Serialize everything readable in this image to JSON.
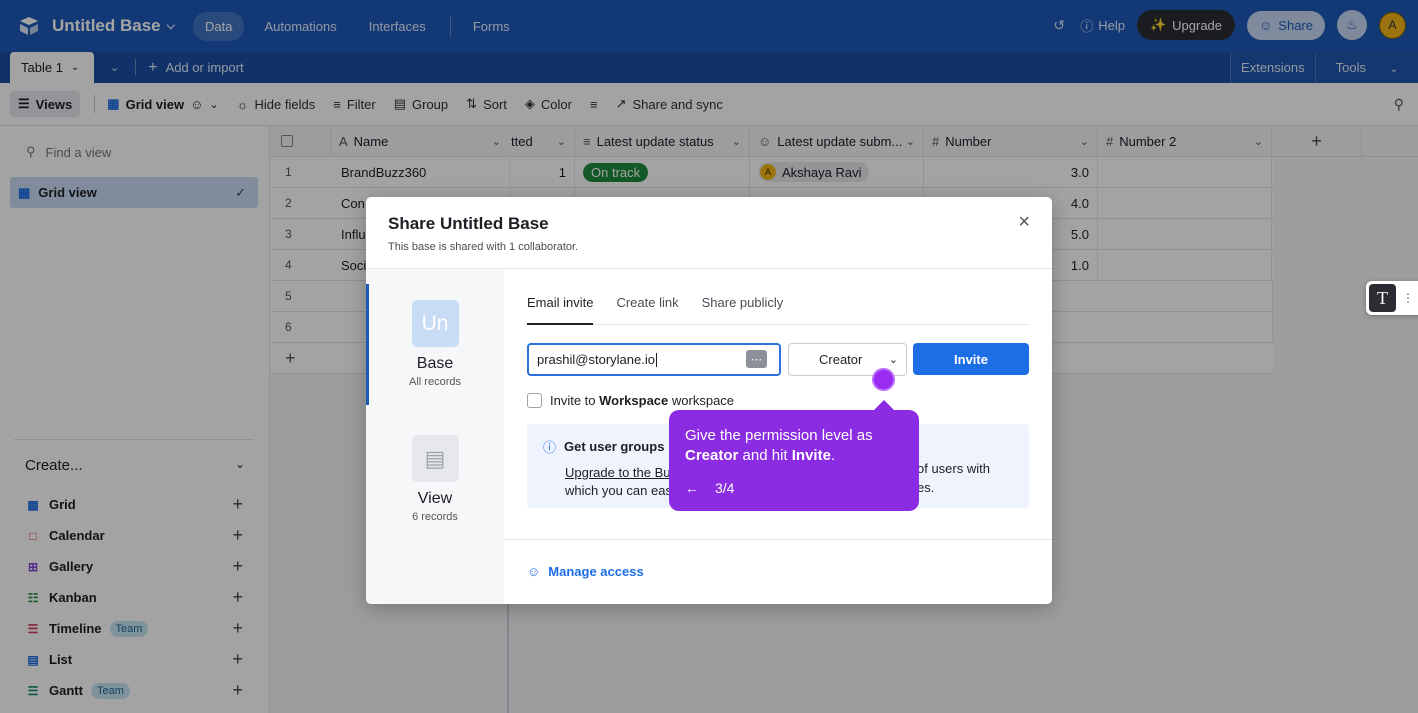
{
  "app": {
    "base_title": "Untitled Base",
    "nav": [
      "Data",
      "Automations",
      "Interfaces",
      "Forms"
    ],
    "help": "Help",
    "upgrade": "Upgrade",
    "share": "Share",
    "avatar_initial": "A"
  },
  "tabbar": {
    "table_tab": "Table 1",
    "add_import": "Add or import",
    "extensions": "Extensions",
    "tools": "Tools"
  },
  "viewbar": {
    "views": "Views",
    "grid_view": "Grid view",
    "hide_fields": "Hide fields",
    "filter": "Filter",
    "group": "Group",
    "sort": "Sort",
    "color": "Color",
    "share_sync": "Share and sync"
  },
  "sidebar": {
    "find_placeholder": "Find a view",
    "active_view": "Grid view",
    "create_label": "Create...",
    "create_items": [
      {
        "label": "Grid",
        "icon": "grid-icon",
        "color": "#1c6ee4",
        "team": false
      },
      {
        "label": "Calendar",
        "icon": "calendar-icon",
        "color": "#d5462f",
        "team": false
      },
      {
        "label": "Gallery",
        "icon": "gallery-icon",
        "color": "#7c3fd6",
        "team": false
      },
      {
        "label": "Kanban",
        "icon": "kanban-icon",
        "color": "#1f8a3d",
        "team": false
      },
      {
        "label": "Timeline",
        "icon": "timeline-icon",
        "color": "#d23a5a",
        "team": true
      },
      {
        "label": "List",
        "icon": "list-icon",
        "color": "#1c6ee4",
        "team": false
      },
      {
        "label": "Gantt",
        "icon": "gantt-icon",
        "color": "#148a6f",
        "team": true
      }
    ],
    "team_badge": "Team"
  },
  "grid": {
    "headers": {
      "name": "Name",
      "submitted": "tted",
      "status": "Latest update status",
      "submitter": "Latest update subm...",
      "number": "Number",
      "number2": "Number 2"
    },
    "rows": [
      {
        "num": "1",
        "name": "BrandBuzz360",
        "submitted": "1",
        "status": "On track",
        "submitter": "Akshaya Ravi",
        "number": "3.0"
      },
      {
        "num": "2",
        "name": "Con",
        "submitted": "",
        "status": "",
        "submitter": "",
        "number": "4.0"
      },
      {
        "num": "3",
        "name": "Influ",
        "submitted": "",
        "status": "",
        "submitter": "",
        "number": "5.0"
      },
      {
        "num": "4",
        "name": "Soci",
        "submitted": "",
        "status": "",
        "submitter": "",
        "number": "1.0"
      },
      {
        "num": "5",
        "name": "",
        "submitted": "",
        "status": "",
        "submitter": "",
        "number": ""
      },
      {
        "num": "6",
        "name": "",
        "submitted": "",
        "status": "",
        "submitter": "",
        "number": ""
      }
    ]
  },
  "modal": {
    "title": "Share Untitled Base",
    "subtitle": "This base is shared with 1 collaborator.",
    "scopes": [
      {
        "tile": "Un",
        "name": "Base",
        "meta": "All records"
      },
      {
        "tile": "",
        "name": "View",
        "meta": "6 records"
      }
    ],
    "tabs": [
      "Email invite",
      "Create link",
      "Share publicly"
    ],
    "email_value": "prashil@storylane.io",
    "role": "Creator",
    "invite": "Invite",
    "invite_workspace_prefix": "Invite to ",
    "invite_workspace_bold": "Workspace",
    "invite_workspace_suffix": " workspace",
    "info_heading": "Get user groups",
    "info_line1": "Upgrade to the Bu",
    "info_line1_tail": "of users with",
    "info_line2": "which you can eas",
    "info_line2_tail": "es.",
    "manage_access": "Manage access"
  },
  "tooltip": {
    "line_prefix": "Give the permission level as ",
    "bold1": "Creator",
    "mid": " and hit ",
    "bold2": "Invite",
    "end": ".",
    "step": "3/4",
    "accent": "#8b2be2"
  }
}
